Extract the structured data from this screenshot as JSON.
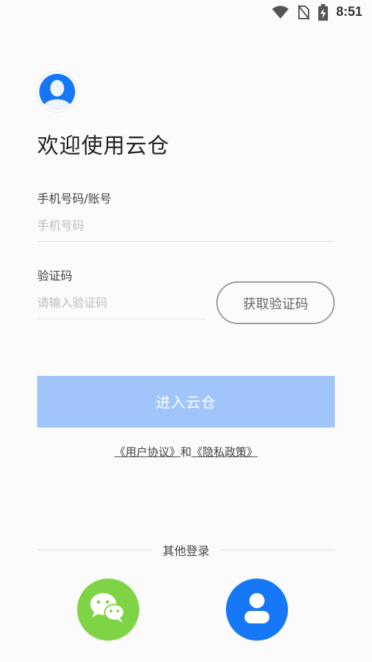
{
  "status_bar": {
    "time": "8:51",
    "icons": [
      "wifi-icon",
      "no-sim-icon",
      "battery-charging-icon"
    ]
  },
  "header": {
    "avatar_icon": "user-avatar-icon",
    "title": "欢迎使用云仓"
  },
  "form": {
    "phone_label": "手机号码/账号",
    "phone_placeholder": "手机号码",
    "phone_value": "",
    "code_label": "验证码",
    "code_placeholder": "请输入验证码",
    "code_value": "",
    "get_code_label": "获取验证码",
    "submit_label": "进入云仓"
  },
  "agreement": {
    "user_agreement": "《用户协议》",
    "connector": "和",
    "privacy_policy": "《隐私政策》"
  },
  "other_login": {
    "label": "其他登录",
    "options": [
      {
        "icon": "wechat-icon",
        "color": "#7ed444"
      },
      {
        "icon": "user-icon",
        "color": "#1677f7"
      }
    ]
  },
  "colors": {
    "primary": "#1677f7",
    "submit_disabled": "#a0c5fb",
    "wechat": "#7ed444",
    "background": "#fbfbfb"
  }
}
